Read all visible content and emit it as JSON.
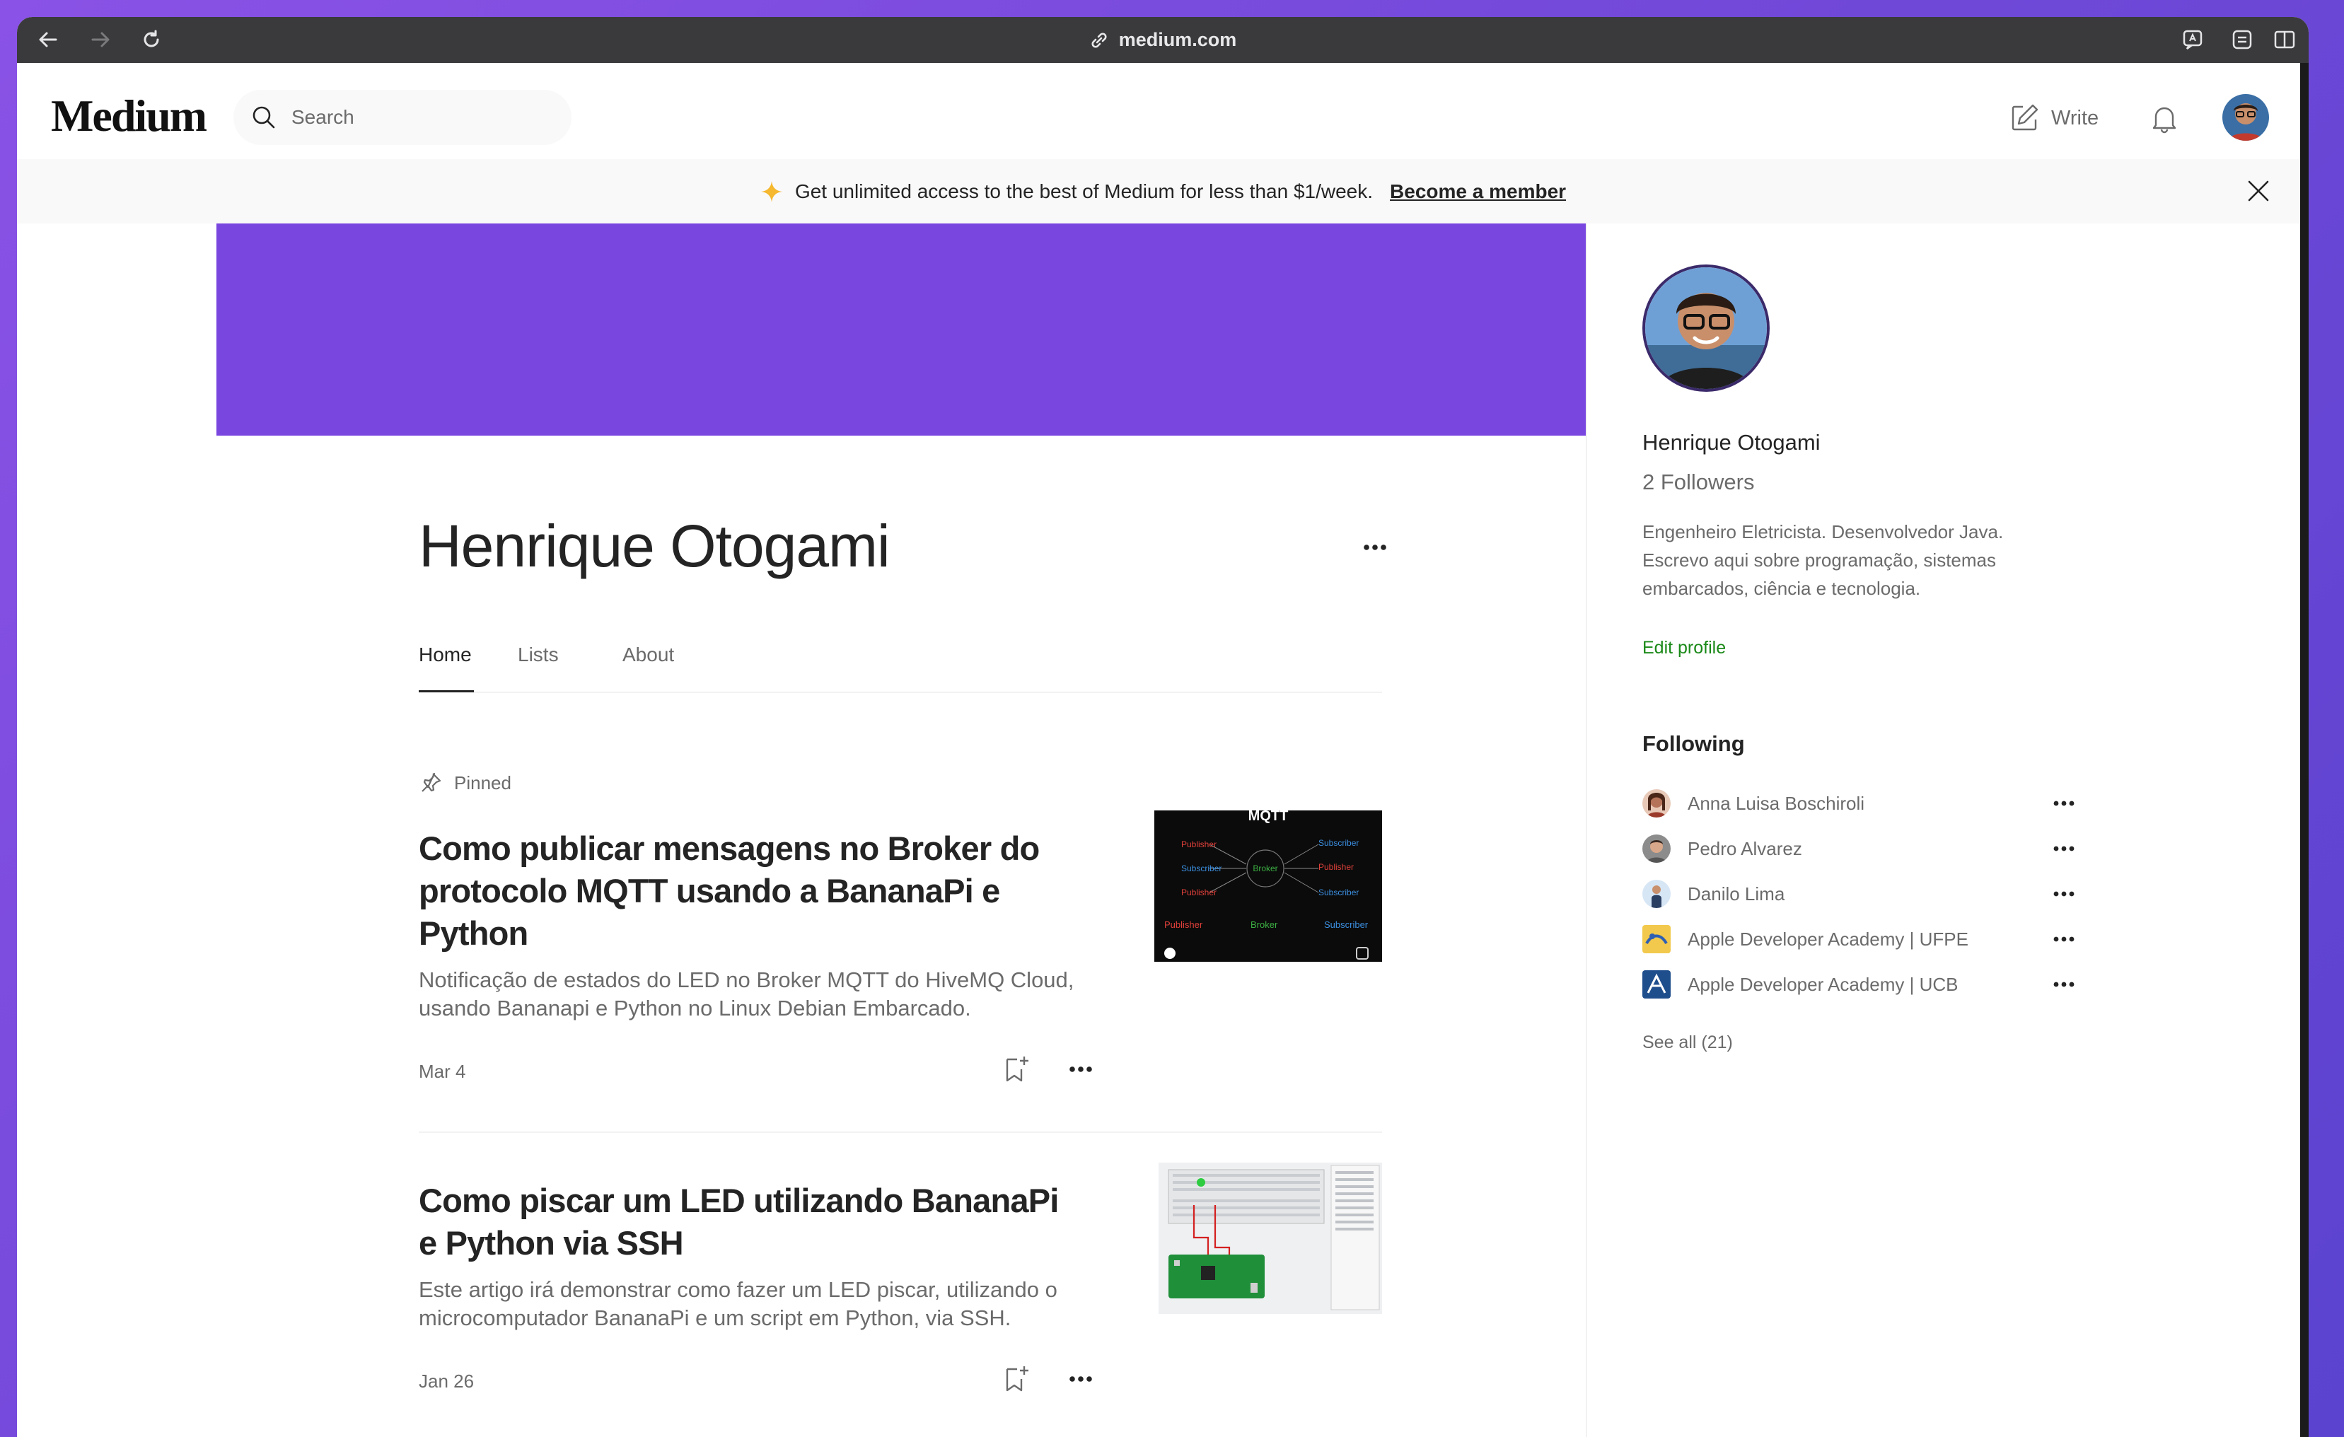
{
  "browser": {
    "url": "medium.com",
    "icons": [
      "back-icon",
      "forward-icon",
      "reload-icon",
      "link-icon",
      "reader-icon",
      "tabs-icon",
      "sidebar-icon"
    ]
  },
  "header": {
    "logo": "Medium",
    "search_placeholder": "Search",
    "write_label": "Write"
  },
  "banner": {
    "text": "Get unlimited access to the best of Medium for less than $1/week.",
    "link": "Become a member"
  },
  "colors": {
    "cover": "#7a46e0",
    "accent_green": "#1a8917",
    "banner_star": "#f5b82e"
  },
  "profile": {
    "name": "Henrique Otogami",
    "tabs": [
      "Home",
      "Lists",
      "About"
    ],
    "active_tab": "Home"
  },
  "articles": [
    {
      "pinned_label": "Pinned",
      "title": "Como publicar mensagens no Broker do protocolo MQTT usando a BananaPi e Python",
      "subtitle": "Notificação de estados do LED no Broker MQTT do HiveMQ Cloud, usando Bananapi e Python no Linux Debian Embarcado.",
      "date": "Mar 4",
      "thumb": {
        "title": "MQTT",
        "left": [
          "Publisher",
          "Subscriber",
          "Publisher"
        ],
        "center": "Broker",
        "right": [
          "Subscriber",
          "Publisher",
          "Subscriber"
        ],
        "bottom": [
          "Publisher",
          "Broker",
          "Subscriber"
        ]
      }
    },
    {
      "title": "Como piscar um LED utilizando BananaPi e Python via SSH",
      "subtitle": "Este artigo irá demonstrar como fazer um LED piscar, utilizando o microcomputador BananaPi e um script em Python, via SSH.",
      "date": "Jan 26"
    }
  ],
  "sidebar": {
    "name": "Henrique Otogami",
    "followers": "2 Followers",
    "bio": "Engenheiro Eletricista. Desenvolvedor Java. Escrevo aqui sobre programação, sistemas embarcados, ciência e tecnologia.",
    "edit_profile": "Edit profile",
    "following_heading": "Following",
    "following": [
      {
        "name": "Anna Luisa Boschiroli"
      },
      {
        "name": "Pedro Alvarez"
      },
      {
        "name": "Danilo Lima"
      },
      {
        "name": "Apple Developer Academy | UFPE"
      },
      {
        "name": "Apple Developer Academy | UCB"
      }
    ],
    "see_all": "See all (21)"
  }
}
